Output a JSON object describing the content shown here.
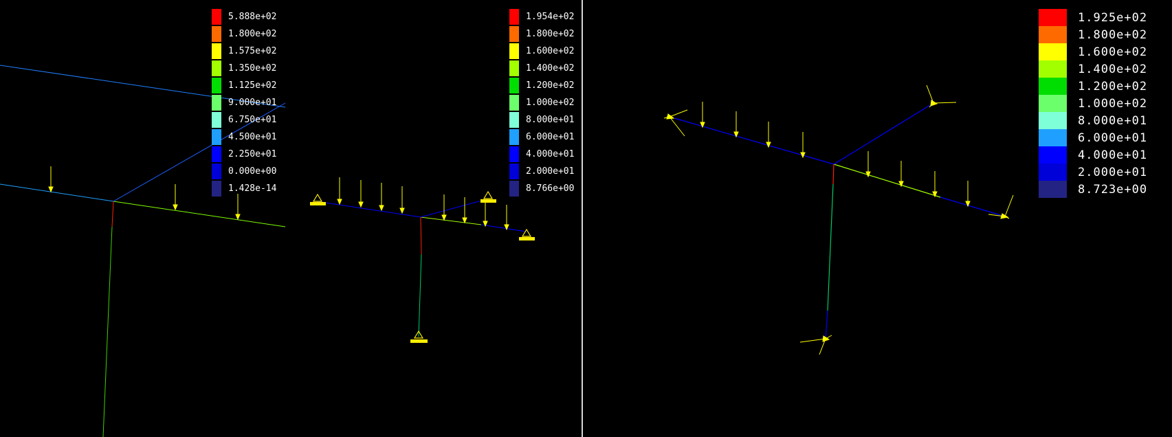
{
  "legends": [
    {
      "labels": [
        "5.888e+02",
        "1.800e+02",
        "1.575e+02",
        "1.350e+02",
        "1.125e+02",
        "9.000e+01",
        "6.750e+01",
        "4.500e+01",
        "2.250e+01",
        "0.000e+00",
        "1.428e-14"
      ]
    },
    {
      "labels": [
        "1.954e+02",
        "1.800e+02",
        "1.600e+02",
        "1.400e+02",
        "1.200e+02",
        "1.000e+02",
        "8.000e+01",
        "6.000e+01",
        "4.000e+01",
        "2.000e+01",
        "8.766e+00"
      ]
    },
    {
      "labels": [
        "1.925e+02",
        "1.800e+02",
        "1.600e+02",
        "1.400e+02",
        "1.200e+02",
        "1.000e+02",
        "8.000e+01",
        "6.000e+01",
        "4.000e+01",
        "2.000e+01",
        "8.723e+00"
      ]
    }
  ],
  "colormap": [
    "#ff0000",
    "#ff6a00",
    "#ffff00",
    "#a2ff00",
    "#00dd00",
    "#6cff6c",
    "#7fffd8",
    "#1f9fff",
    "#0000ff",
    "#0000d8",
    "#232383"
  ],
  "colors": {
    "background": "#000000",
    "divider": "#d8d8d8",
    "load_arrow": "#ffff00",
    "support": "#ffee00"
  }
}
